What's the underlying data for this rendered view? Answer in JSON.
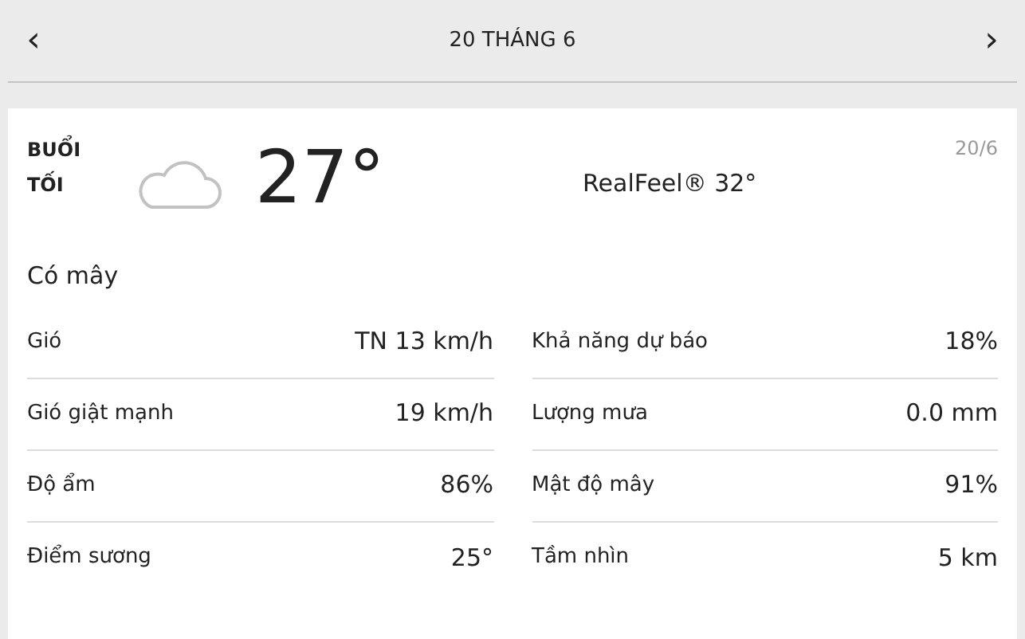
{
  "header": {
    "prev": "‹",
    "title": "20 THÁNG 6",
    "next": "›"
  },
  "card": {
    "period": "BUỔI TỐI",
    "temperature": "27°",
    "realfeel": "RealFeel® 32°",
    "date": "20/6",
    "condition": "Có mây"
  },
  "details": [
    [
      {
        "label": "Gió",
        "value": "TN 13 km/h"
      },
      {
        "label": "Gió giật mạnh",
        "value": "19 km/h"
      },
      {
        "label": "Độ ẩm",
        "value": "86%"
      },
      {
        "label": "Điểm sương",
        "value": "25°"
      }
    ],
    [
      {
        "label": "Khả năng dự báo",
        "value": "18%"
      },
      {
        "label": "Lượng mưa",
        "value": "0.0 mm"
      },
      {
        "label": "Mật độ mây",
        "value": "91%"
      },
      {
        "label": "Tầm nhìn",
        "value": "5 km"
      }
    ]
  ]
}
